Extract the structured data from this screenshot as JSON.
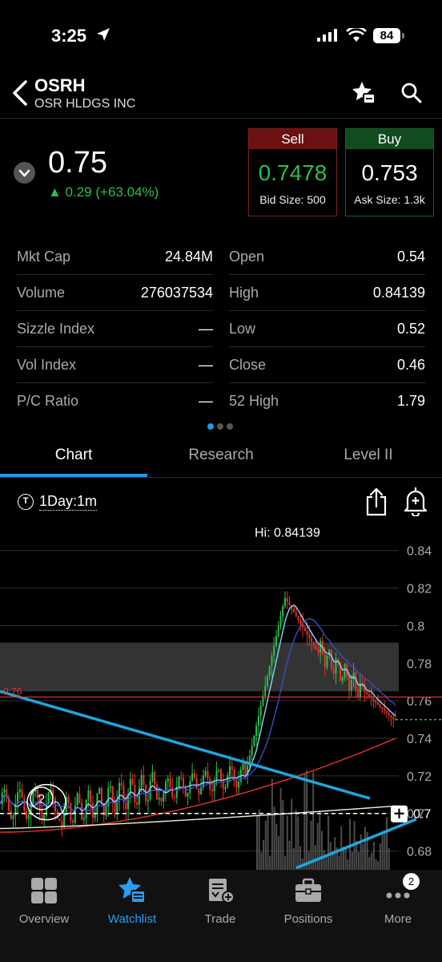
{
  "status": {
    "time": "3:25",
    "battery": "84"
  },
  "header": {
    "symbol": "OSRH",
    "company": "OSR HLDGS INC"
  },
  "quote": {
    "price": "0.75",
    "change": "▲ 0.29 (+63.04%)"
  },
  "sell": {
    "label": "Sell",
    "price": "0.7478",
    "size": "Bid Size: 500"
  },
  "buy": {
    "label": "Buy",
    "price": "0.753",
    "size": "Ask Size: 1.3k"
  },
  "stats_left": [
    {
      "k": "Mkt Cap",
      "v": "24.84M"
    },
    {
      "k": "Volume",
      "v": "276037534"
    },
    {
      "k": "Sizzle Index",
      "v": "—"
    },
    {
      "k": "Vol Index",
      "v": "—"
    },
    {
      "k": "P/C Ratio",
      "v": "—"
    }
  ],
  "stats_right": [
    {
      "k": "Open",
      "v": "0.54"
    },
    {
      "k": "High",
      "v": "0.84139"
    },
    {
      "k": "Low",
      "v": "0.52"
    },
    {
      "k": "Close",
      "v": "0.46"
    },
    {
      "k": "52 High",
      "v": "1.79"
    }
  ],
  "tabs": [
    "Chart",
    "Research",
    "Level II"
  ],
  "chart_toolbar": {
    "timeframe": "1Day:1m",
    "tf_icon": "T"
  },
  "chart_data": {
    "type": "line",
    "timeframe": "1Day:1m",
    "ylim": [
      0.67,
      0.845
    ],
    "y_ticks": [
      "0.84",
      "0.82",
      "0.8",
      "0.78",
      "0.76",
      "0.74",
      "0.72",
      "0.7",
      "0.68"
    ],
    "hi_label": "Hi: 0.84139",
    "hi_value": 0.84139,
    "red_line_label": "0.76",
    "red_line_value": 0.762,
    "cursor_label": "0.7",
    "cursor_value": 0.7,
    "last_price": 0.75,
    "shaded_zone": [
      0.765,
      0.791
    ],
    "colors": {
      "up": "#26c24a",
      "down": "#e8342b",
      "fast_ma": "#8fd0ff",
      "slow_ma": "#3a4cc8",
      "vwap": "#e8342b",
      "ma200": "#f0f5d8",
      "trend": "#1ea6df"
    },
    "marker": "?"
  },
  "nav": [
    {
      "label": "Overview",
      "icon": "overview-icon"
    },
    {
      "label": "Watchlist",
      "icon": "watchlist-icon"
    },
    {
      "label": "Trade",
      "icon": "trade-icon"
    },
    {
      "label": "Positions",
      "icon": "positions-icon"
    },
    {
      "label": "More",
      "icon": "more-icon"
    }
  ],
  "nav_badge": "2"
}
